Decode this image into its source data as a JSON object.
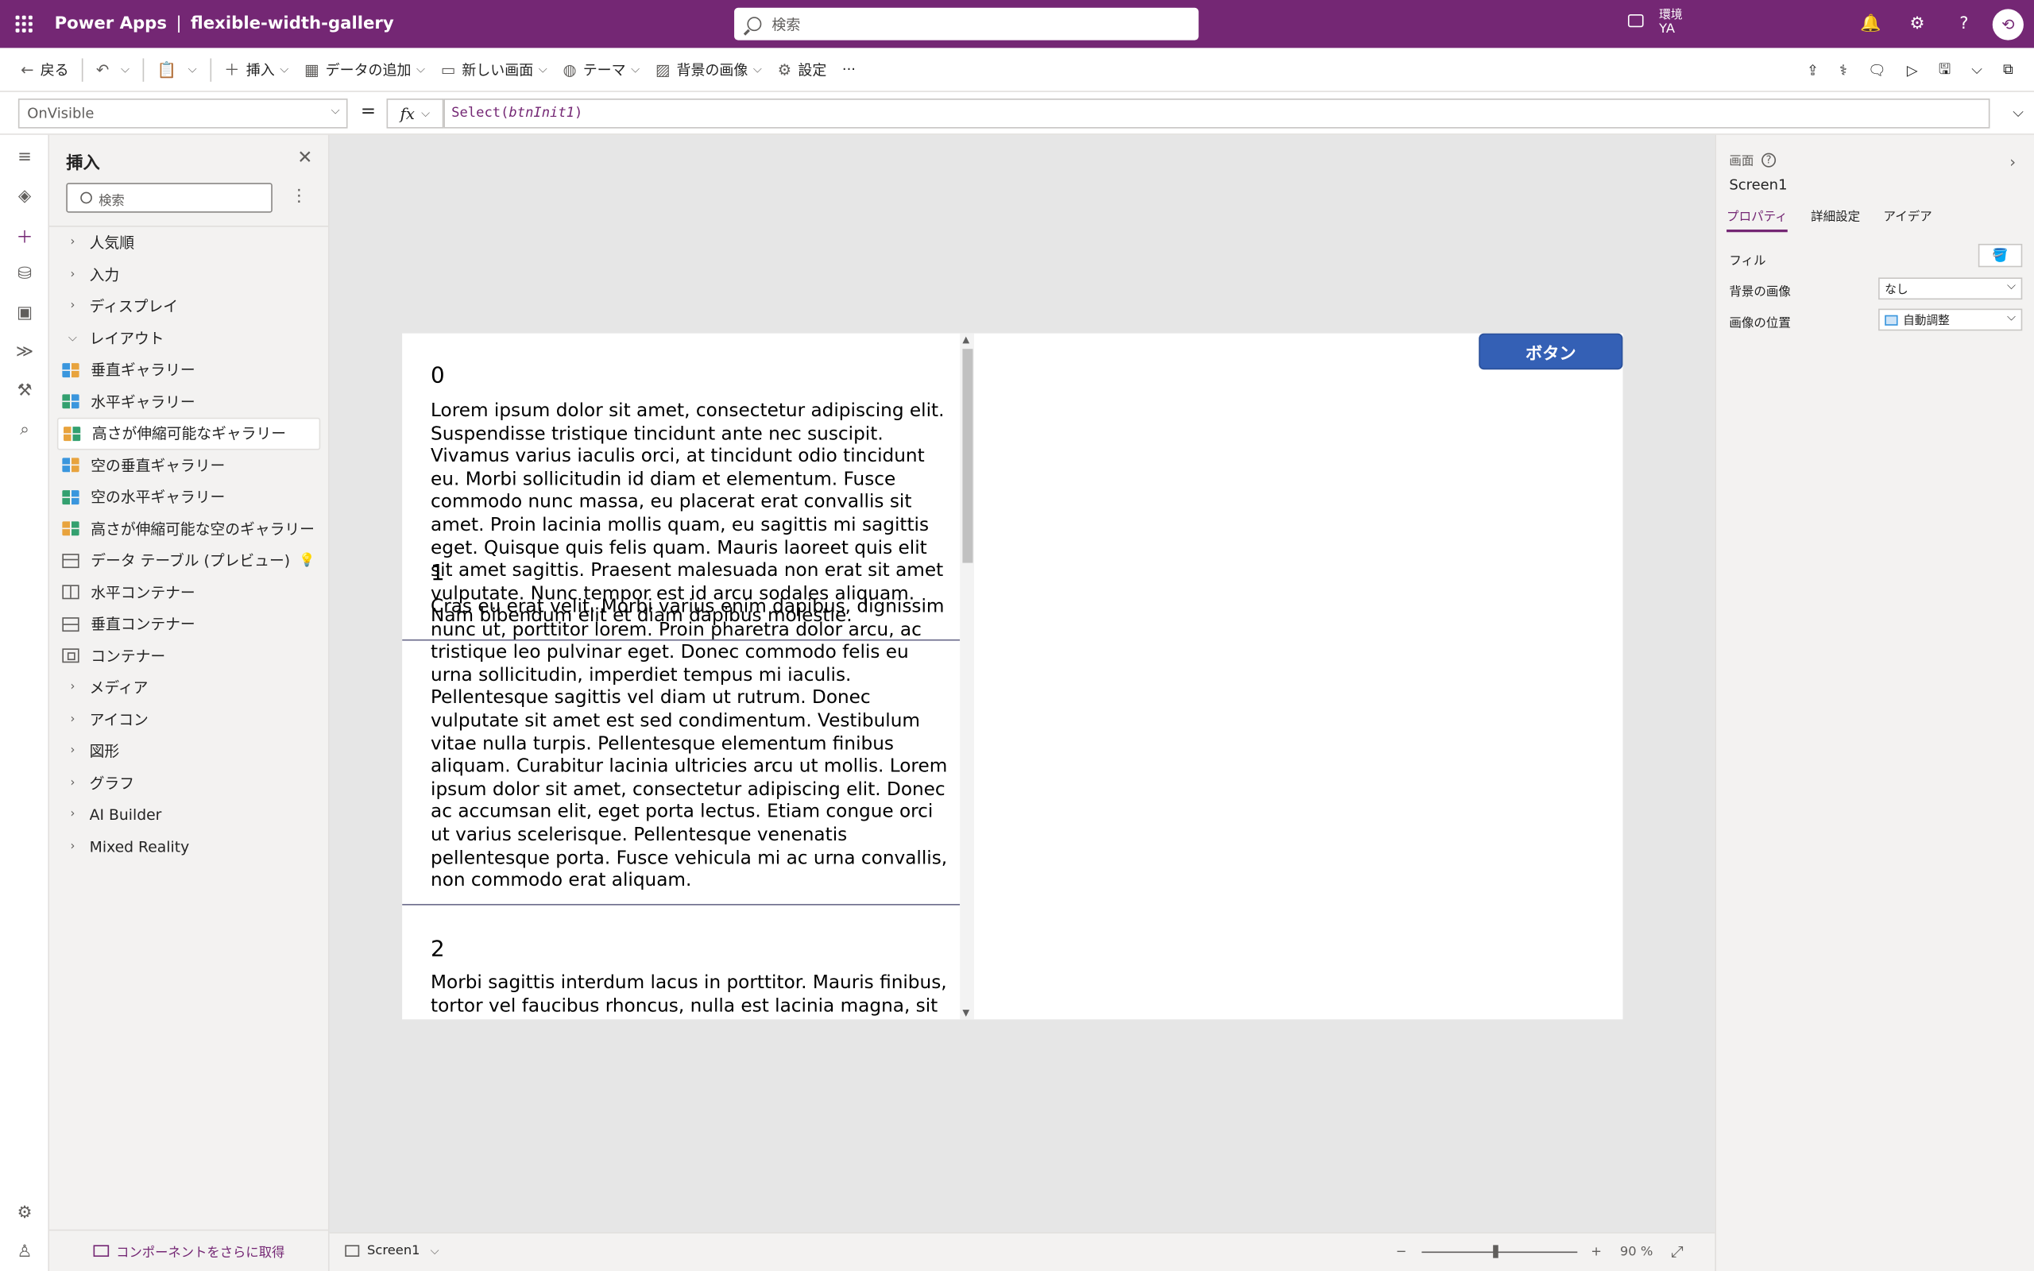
{
  "header": {
    "app_name": "Power Apps",
    "separator": "|",
    "document_title": "flexible-width-gallery",
    "search_placeholder": "検索",
    "env_label": "環境",
    "env_value": "YA"
  },
  "commandbar": {
    "back": "戻る",
    "insert": "挿入",
    "add_data": "データの追加",
    "new_screen": "新しい画面",
    "theme": "テーマ",
    "background_image": "背景の画像",
    "settings": "設定",
    "more": "···"
  },
  "formula_bar": {
    "property": "OnVisible",
    "equals": "=",
    "fx": "fx",
    "formula_fn": "Select(",
    "formula_arg": "btnInit1",
    "formula_close": ")"
  },
  "insert_pane": {
    "title": "挿入",
    "search_placeholder": "検索",
    "items": [
      {
        "label": "人気順",
        "type": "group",
        "expanded": false
      },
      {
        "label": "入力",
        "type": "group",
        "expanded": false
      },
      {
        "label": "ディスプレイ",
        "type": "group",
        "expanded": false
      },
      {
        "label": "レイアウト",
        "type": "group",
        "expanded": true
      },
      {
        "label": "垂直ギャラリー",
        "type": "child",
        "icon": "gallery-icon"
      },
      {
        "label": "水平ギャラリー",
        "type": "child",
        "icon": "gallery-icon"
      },
      {
        "label": "高さが伸縮可能なギャラリー",
        "type": "child",
        "icon": "gallery-icon",
        "selected": true
      },
      {
        "label": "空の垂直ギャラリー",
        "type": "child",
        "icon": "gallery-icon"
      },
      {
        "label": "空の水平ギャラリー",
        "type": "child",
        "icon": "gallery-icon"
      },
      {
        "label": "高さが伸縮可能な空のギャラリー",
        "type": "child",
        "icon": "gallery-icon"
      },
      {
        "label": "データ テーブル (プレビュー)",
        "type": "child",
        "icon": "table-icon"
      },
      {
        "label": "水平コンテナー",
        "type": "child",
        "icon": "horizontal-container-icon"
      },
      {
        "label": "垂直コンテナー",
        "type": "child",
        "icon": "vertical-container-icon"
      },
      {
        "label": "コンテナー",
        "type": "child",
        "icon": "container-icon"
      },
      {
        "label": "メディア",
        "type": "group",
        "expanded": false
      },
      {
        "label": "アイコン",
        "type": "group",
        "expanded": false
      },
      {
        "label": "図形",
        "type": "group",
        "expanded": false
      },
      {
        "label": "グラフ",
        "type": "group",
        "expanded": false
      },
      {
        "label": "AI Builder",
        "type": "group",
        "expanded": false
      },
      {
        "label": "Mixed Reality",
        "type": "group",
        "expanded": false
      }
    ],
    "footer": "コンポーネントをさらに取得"
  },
  "canvas": {
    "button_label": "ボタン",
    "gallery": [
      {
        "title": "0",
        "text": "Lorem ipsum dolor sit amet, consectetur adipiscing elit. Suspendisse tristique tincidunt ante nec suscipit. Vivamus varius iaculis orci, at tincidunt odio tincidunt eu. Morbi sollicitudin id diam et elementum. Fusce commodo nunc massa, eu placerat erat convallis sit amet. Proin lacinia mollis quam, eu sagittis mi sagittis eget. Quisque quis felis quam. Mauris laoreet quis elit sit amet sagittis. Praesent malesuada non erat sit amet vulputate. Nunc tempor est id arcu sodales aliquam. Nam bibendum elit et diam dapibus molestie."
      },
      {
        "title": "1",
        "text": "Cras eu erat velit. Morbi varius enim dapibus, dignissim nunc ut, porttitor lorem. Proin pharetra dolor arcu, ac tristique leo pulvinar eget. Donec commodo felis eu urna sollicitudin, imperdiet tempus mi iaculis. Pellentesque sagittis vel diam ut rutrum. Donec vulputate sit amet est sed condimentum. Vestibulum vitae nulla turpis. Pellentesque elementum finibus aliquam. Curabitur lacinia ultricies arcu ut mollis. Lorem ipsum dolor sit amet, consectetur adipiscing elit. Donec ac accumsan elit, eget porta lectus. Etiam congue orci ut varius scelerisque. Pellentesque venenatis pellentesque porta. Fusce vehicula mi ac urna convallis, non commodo erat aliquam."
      },
      {
        "title": "2",
        "text": "Morbi sagittis interdum lacus in porttitor. Mauris finibus, tortor vel faucibus rhoncus, nulla est lacinia magna, sit"
      }
    ]
  },
  "statusbar": {
    "screen_tab": "Screen1",
    "zoom_minus": "−",
    "zoom_plus": "+",
    "zoom_value": "90",
    "zoom_unit": "%"
  },
  "properties": {
    "type_label": "画面",
    "name": "Screen1",
    "tabs": [
      "プロパティ",
      "詳細設定",
      "アイデア"
    ],
    "fill_label": "フィル",
    "bg_image_label": "背景の画像",
    "bg_image_value": "なし",
    "image_position_label": "画像の位置",
    "image_position_value": "自動調整"
  },
  "colors": {
    "brand": "#742774",
    "button": "#3460b5"
  }
}
